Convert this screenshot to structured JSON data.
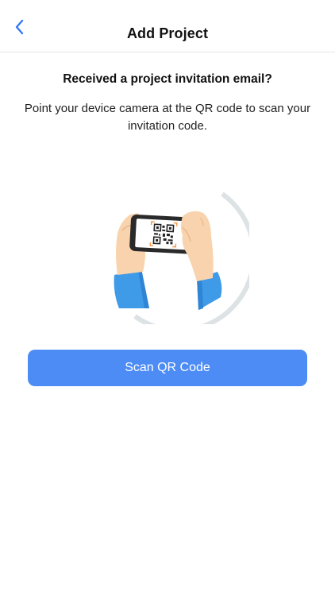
{
  "nav": {
    "title": "Add Project",
    "back_icon": "chevron-left-icon"
  },
  "content": {
    "heading": "Received a project invitation email?",
    "description": "Point your device camera at the QR code to scan your invitation code.",
    "illustration": "phone-scanning-qr-illustration"
  },
  "actions": {
    "scan_label": "Scan QR Code"
  },
  "colors": {
    "accent": "#4d8cf5",
    "back_icon": "#3478f6",
    "sleeve": "#3f9ae8",
    "skin": "#f8d3ad",
    "qr_corner": "#f39a4a"
  }
}
